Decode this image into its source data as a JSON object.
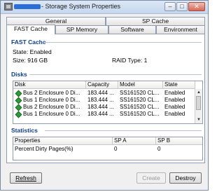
{
  "window": {
    "title": "- Storage System Properties"
  },
  "tabs_top": [
    "General",
    "SP Cache"
  ],
  "tabs_bottom": [
    "FAST Cache",
    "SP Memory",
    "Software",
    "Environment"
  ],
  "fast_cache": {
    "heading": "FAST Cache",
    "state": "State: Enabled",
    "size": "Size: 916 GB",
    "raid": "RAID Type: 1"
  },
  "disks": {
    "heading": "Disks",
    "columns": [
      "Disk",
      "Capacity",
      "Model",
      "State"
    ],
    "rows": [
      [
        "Bus 2 Enclosure 0 Di...",
        "183.444 ...",
        "SS161520 CL...",
        "Enabled"
      ],
      [
        "Bus 1 Enclosure 0 Di...",
        "183.444 ...",
        "SS161520 CL...",
        "Enabled"
      ],
      [
        "Bus 2 Enclosure 0 Di...",
        "183.444 ...",
        "SS161520 CL...",
        "Enabled"
      ],
      [
        "Bus 1 Enclosure 0 Di...",
        "183.444 ...",
        "SS161520 CL...",
        "Enabled"
      ]
    ]
  },
  "statistics": {
    "heading": "Statistics",
    "columns": [
      "Properties",
      "SP A",
      "SP B"
    ],
    "rows": [
      [
        "Percent Dirty Pages(%)",
        "0",
        "0"
      ]
    ]
  },
  "buttons": {
    "refresh": "Refresh",
    "create": "Create",
    "destroy": "Destroy"
  }
}
